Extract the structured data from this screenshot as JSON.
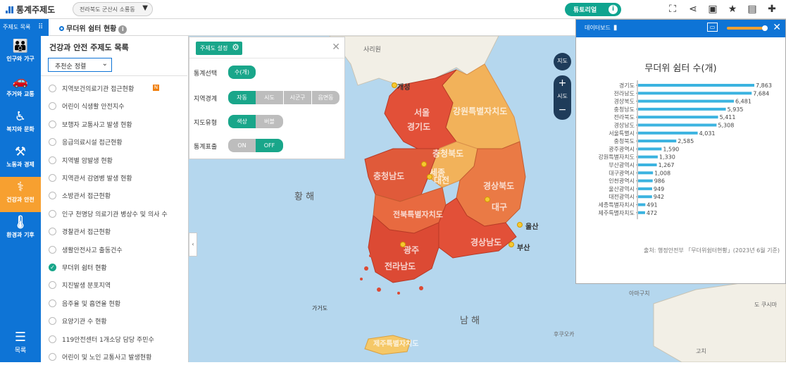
{
  "app": {
    "title": "통계주제도",
    "region": "전라북도 군산시 소룡동",
    "tutorial": "튜토리얼"
  },
  "secondbar": {
    "theme_list_button": "주제도 목록",
    "map_title": "무더위 쉼터 현황"
  },
  "sidebar": {
    "categories": [
      {
        "label": "인구와 가구",
        "icon": "people-icon"
      },
      {
        "label": "주거와 교통",
        "icon": "car-house-icon"
      },
      {
        "label": "복지와 문화",
        "icon": "welfare-icon"
      },
      {
        "label": "노동과 경제",
        "icon": "worker-icon"
      },
      {
        "label": "건강과 안전",
        "icon": "health-icon"
      },
      {
        "label": "환경과 기후",
        "icon": "environment-icon"
      }
    ],
    "active_index": 4,
    "list_label": "목록"
  },
  "listpanel": {
    "title": "건강과 안전 주제도 목록",
    "sort": "추천순 정렬",
    "items": [
      "지역보건의료기관 접근현황",
      "어린이 식생활 안전지수",
      "보행자 교통사고 발생 현황",
      "응급의료시설 접근현황",
      "지역별 암발생 현황",
      "지역관서 감염병 발생 현황",
      "소방관서 접근현황",
      "인구 천명당 의료기관 병상수 및 의사 수",
      "경찰관서 접근현황",
      "생활안전사고 출동건수",
      "무더위 쉼터 현황",
      "지진발생 분포지역",
      "음주율 및 흡연율 현황",
      "요양기관 수 현황",
      "119안전센터 1개소당 담당 주민수",
      "어린이 및 노인 교통사고 발생현황"
    ],
    "new_badge": "N",
    "selected_index": 10
  },
  "theme_setting": {
    "button": "주제도 설정",
    "rows": [
      {
        "label": "통계선택",
        "options": [
          "수(개)"
        ],
        "active": 0
      },
      {
        "label": "지역경계",
        "options": [
          "자동",
          "시도",
          "시군구",
          "읍면동"
        ],
        "active": 0
      },
      {
        "label": "지도유형",
        "options": [
          "색상",
          "버블"
        ],
        "active": 0
      },
      {
        "label": "통계표출",
        "options": [
          "ON",
          "OFF"
        ],
        "active": 1
      }
    ]
  },
  "map": {
    "sea_labels": [
      "황 해",
      "남 해"
    ],
    "places": [
      "사리원",
      "개성",
      "울산",
      "부산",
      "가거도",
      "아마구치",
      "도 쿠시마",
      "후쿠오카",
      "고치"
    ],
    "provinces": [
      "서울",
      "경기도",
      "강원특별자치도",
      "충청북도",
      "충청남도",
      "세종",
      "대전",
      "경상북도",
      "대구",
      "전북특별자치도",
      "광주",
      "전라남도",
      "경상남도",
      "제주특별자치도"
    ],
    "zoom_in": "+",
    "zoom_level": "시도",
    "zoom_out": "−",
    "compass": "지도"
  },
  "dashboard": {
    "header": "데이터보드",
    "source": "출처: 행정안전부 「무더위쉼터현황」(2023년 6월 기준)"
  },
  "chart_data": {
    "type": "bar",
    "orientation": "horizontal",
    "title": "무더위 쉼터 수(개)",
    "categories": [
      "경기도",
      "전라남도",
      "경상북도",
      "충청남도",
      "전라북도",
      "경상남도",
      "서울특별시",
      "충청북도",
      "광주광역시",
      "강원특별자치도",
      "부산광역시",
      "대구광역시",
      "인천광역시",
      "울산광역시",
      "대전광역시",
      "세종특별자치시",
      "제주특별자치도"
    ],
    "values": [
      7863,
      7684,
      6481,
      5935,
      5411,
      5308,
      4031,
      2585,
      1590,
      1330,
      1267,
      1008,
      986,
      949,
      942,
      491,
      472
    ],
    "value_labels": [
      "7,863",
      "7,684",
      "6,481",
      "5,935",
      "5,411",
      "5,308",
      "4,031",
      "2,585",
      "1,590",
      "1,330",
      "1,267",
      "1,008",
      "986",
      "949",
      "942",
      "491",
      "472"
    ],
    "xlim": [
      0,
      8400
    ],
    "bar_color": "#3bb3e0"
  }
}
